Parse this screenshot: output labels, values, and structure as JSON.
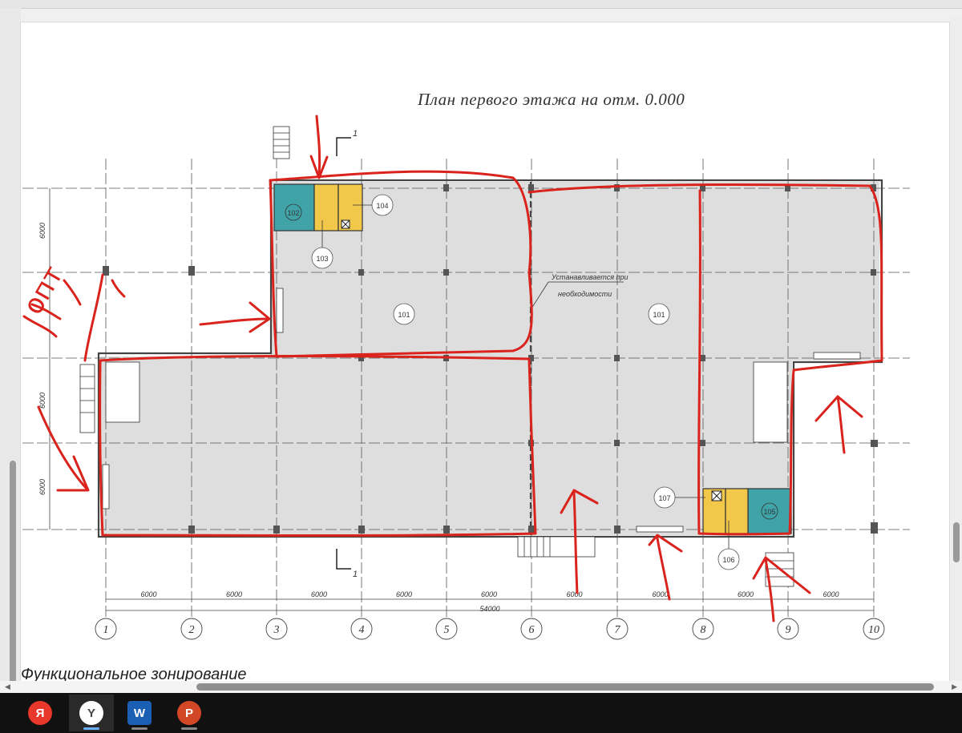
{
  "plan": {
    "title": "План первого этажа на отм. 0.000",
    "section_heading": "Функциональное зонирование",
    "note_line1": "Устанавливается при",
    "note_line2": "необходимости",
    "section_mark": "1",
    "spans": [
      "6000",
      "6000",
      "6000",
      "6000",
      "6000",
      "6000",
      "6000",
      "6000",
      "6000"
    ],
    "total_span": "54000",
    "left_dims": [
      "6000",
      "6000",
      "6000"
    ],
    "axes": [
      "1",
      "2",
      "3",
      "4",
      "5",
      "6",
      "7",
      "8",
      "9",
      "10"
    ],
    "rooms": {
      "r101a": "101",
      "r101b": "101",
      "r102": "102",
      "r103": "103",
      "r104": "104",
      "r105": "105",
      "r106": "106",
      "r107": "107"
    },
    "handwritten_note": "опт"
  },
  "colors": {
    "floor": "#dedede",
    "red_markup": "#d9231c",
    "teal_room": "#3fa3a8",
    "yellow_room": "#f2c84b"
  },
  "taskbar": {
    "items": [
      {
        "name": "yandex-icon",
        "label": "Я"
      },
      {
        "name": "yandex-browser-icon",
        "label": "Y"
      },
      {
        "name": "word-icon",
        "label": "W"
      },
      {
        "name": "powerpoint-icon",
        "label": "P"
      }
    ]
  }
}
